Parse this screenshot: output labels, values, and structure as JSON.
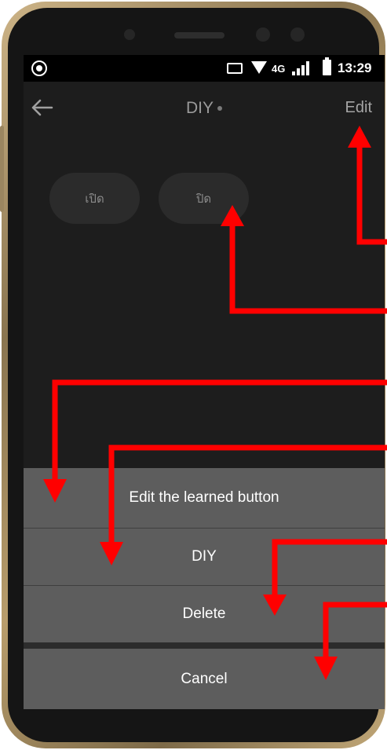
{
  "status_bar": {
    "network": "4G",
    "time": "13:29"
  },
  "app_bar": {
    "title": "DIY",
    "edit_label": "Edit"
  },
  "learned_buttons": [
    {
      "label": "เปิด"
    },
    {
      "label": "ปิด"
    }
  ],
  "action_sheet": {
    "items": [
      {
        "label": "Edit the learned button"
      },
      {
        "label": "DIY"
      },
      {
        "label": "Delete"
      }
    ],
    "cancel_label": "Cancel"
  },
  "colors": {
    "screen_bg": "#1d1d1d",
    "sheet_bg": "#5d5d5d",
    "annotation_arrow": "#ff0000"
  },
  "icons": [
    "camera-icon",
    "cast-icon",
    "wifi-icon",
    "signal-icon",
    "battery-icon",
    "back-arrow-icon"
  ]
}
